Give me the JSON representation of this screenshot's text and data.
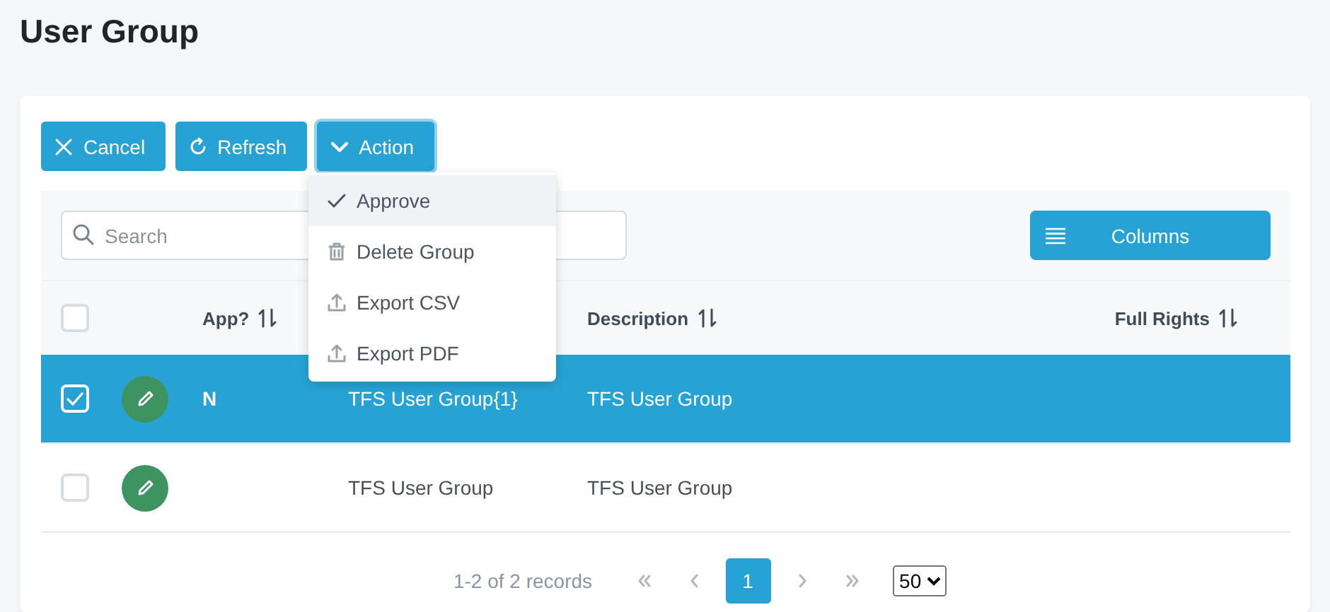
{
  "page": {
    "title": "User Group"
  },
  "toolbar": [
    {
      "kind": "cancel",
      "label": "Cancel",
      "focused": false
    },
    {
      "kind": "refresh",
      "label": "Refresh",
      "focused": false
    },
    {
      "kind": "action",
      "label": "Action",
      "focused": true
    }
  ],
  "action_menu": [
    {
      "kind": "approve",
      "label": "Approve",
      "highlighted": true
    },
    {
      "kind": "delete",
      "label": "Delete Group",
      "highlighted": false
    },
    {
      "kind": "export",
      "label": "Export CSV",
      "highlighted": false
    },
    {
      "kind": "export",
      "label": "Export PDF",
      "highlighted": false
    }
  ],
  "search": {
    "placeholder": "Search"
  },
  "columns_button": {
    "label": "Columns"
  },
  "table": {
    "all_checked": false,
    "columns": [
      {
        "label": "App?"
      },
      {
        "label": "Description"
      },
      {
        "label": "Full Rights"
      }
    ],
    "rows": [
      {
        "selected": true,
        "app": "N",
        "column_4": "TFS User Group{1}",
        "description": "TFS User Group"
      },
      {
        "selected": false,
        "column_4": "TFS User Group",
        "description": "TFS User Group"
      }
    ]
  },
  "pagination": {
    "summary": "1-2 of 2 records",
    "pages": [
      {
        "label": "1",
        "selected": true
      }
    ],
    "page_size": "50"
  }
}
